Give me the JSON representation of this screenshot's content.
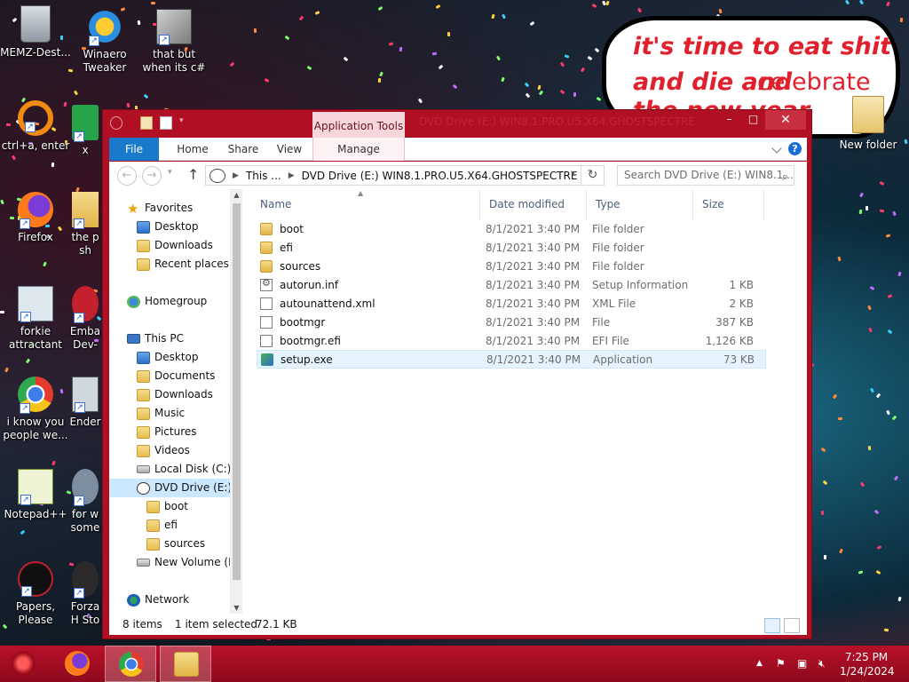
{
  "desktop": {
    "icons": [
      {
        "label": "MEMZ-Dest..."
      },
      {
        "label": "Winaero Tweaker"
      },
      {
        "label": "that but when its c#"
      },
      {
        "label": "ctrl+a, enter"
      },
      {
        "label": "x"
      },
      {
        "label": "Firefox"
      },
      {
        "label": "the p sh"
      },
      {
        "label": "forkie attractant"
      },
      {
        "label": "Emba Dev-"
      },
      {
        "label": "i know you people we..."
      },
      {
        "label": "Ender"
      },
      {
        "label": "Notepad++"
      },
      {
        "label": "for w some"
      },
      {
        "label": "Papers, Please"
      },
      {
        "label": "Forza H Sto"
      }
    ],
    "new_folder_label": "New folder",
    "wallpaper_text": [
      "it's time to eat shit",
      "and die and",
      "celebrate",
      "the new year"
    ]
  },
  "window": {
    "title": "DVD Drive (E:) WIN8.1.PRO.U5.X64.GHOSTSPECTRE",
    "context_tab": "Application Tools",
    "controls": {
      "minimize": "–",
      "maximize": "□",
      "close": "✕"
    },
    "ribbon_tabs": [
      "File",
      "Home",
      "Share",
      "View",
      "Manage"
    ],
    "address": {
      "segments": [
        "This ...",
        "DVD Drive (E:) WIN8.1.PRO.U5.X64.GHOSTSPECTRE"
      ],
      "search_placeholder": "Search DVD Drive (E:) WIN8.1...."
    },
    "nav": {
      "favorites": "Favorites",
      "favorites_items": [
        "Desktop",
        "Downloads",
        "Recent places"
      ],
      "homegroup": "Homegroup",
      "this_pc": "This PC",
      "pc_items": [
        "Desktop",
        "Documents",
        "Downloads",
        "Music",
        "Pictures",
        "Videos",
        "Local Disk (C:)",
        "DVD Drive (E:) WI"
      ],
      "dvd_children": [
        "boot",
        "efi",
        "sources"
      ],
      "new_volume": "New Volume (F:)",
      "network": "Network"
    },
    "columns": {
      "name": "Name",
      "date": "Date modified",
      "type": "Type",
      "size": "Size"
    },
    "files": [
      {
        "name": "boot",
        "date": "8/1/2021 3:40 PM",
        "type": "File folder",
        "size": "",
        "icon": "folder-icon"
      },
      {
        "name": "efi",
        "date": "8/1/2021 3:40 PM",
        "type": "File folder",
        "size": "",
        "icon": "folder-icon"
      },
      {
        "name": "sources",
        "date": "8/1/2021 3:40 PM",
        "type": "File folder",
        "size": "",
        "icon": "folder-icon"
      },
      {
        "name": "autorun.inf",
        "date": "8/1/2021 3:40 PM",
        "type": "Setup Information",
        "size": "1 KB",
        "icon": "setup-info-icon"
      },
      {
        "name": "autounattend.xml",
        "date": "8/1/2021 3:40 PM",
        "type": "XML File",
        "size": "2 KB",
        "icon": "document-icon"
      },
      {
        "name": "bootmgr",
        "date": "8/1/2021 3:40 PM",
        "type": "File",
        "size": "387 KB",
        "icon": "document-icon"
      },
      {
        "name": "bootmgr.efi",
        "date": "8/1/2021 3:40 PM",
        "type": "EFI File",
        "size": "1,126 KB",
        "icon": "document-icon"
      },
      {
        "name": "setup.exe",
        "date": "8/1/2021 3:40 PM",
        "type": "Application",
        "size": "73 KB",
        "icon": "setup-exe-icon"
      }
    ],
    "status": {
      "count": "8 items",
      "selection": "1 item selected",
      "size": "72.1 KB"
    }
  },
  "taskbar": {
    "time": "7:25 PM",
    "date": "1/24/2024"
  },
  "colors": {
    "accent": "#b10f24",
    "file_tab": "#1979ca",
    "selection": "#e5f3ff"
  }
}
